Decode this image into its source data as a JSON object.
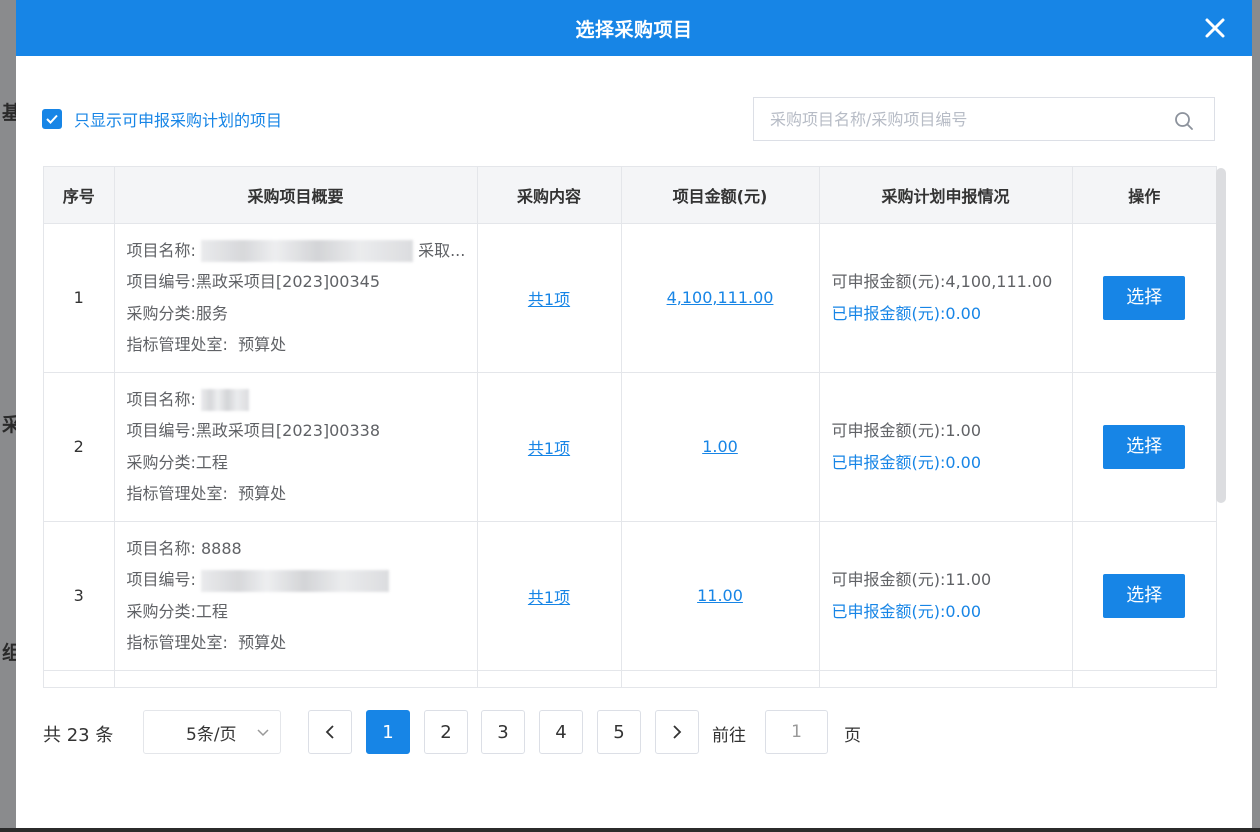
{
  "dialog": {
    "title": "选择采购项目"
  },
  "filter": {
    "checkbox_label": "只显示可申报采购计划的项目",
    "checked": true,
    "search_placeholder": "采购项目名称/采购项目编号",
    "search_value": ""
  },
  "table": {
    "headers": [
      "序号",
      "采购项目概要",
      "采购内容",
      "项目金额(元)",
      "采购计划申报情况",
      "操作"
    ],
    "rows": [
      {
        "index": "1",
        "name_label": "项目名称:",
        "name_value": "",
        "name_suffix": "采取...",
        "code_label": "项目编号:",
        "code_value": "黑政采项目[2023]00345",
        "category_label": "采购分类:",
        "category_value": "服务",
        "dept_label": "指标管理处室:",
        "dept_value": "预算处",
        "content": "共1项",
        "amount": "4,100,111.00",
        "avail_label": "可申报金额(元):",
        "avail_value": "4,100,111.00",
        "done_label": "已申报金额(元):",
        "done_value": "0.00",
        "action": "选择"
      },
      {
        "index": "2",
        "name_label": "项目名称:",
        "name_value": "",
        "name_suffix": "",
        "code_label": "项目编号:",
        "code_value": "黑政采项目[2023]00338",
        "category_label": "采购分类:",
        "category_value": "工程",
        "dept_label": "指标管理处室:",
        "dept_value": "预算处",
        "content": "共1项",
        "amount": "1.00",
        "avail_label": "可申报金额(元):",
        "avail_value": "1.00",
        "done_label": "已申报金额(元):",
        "done_value": "0.00",
        "action": "选择"
      },
      {
        "index": "3",
        "name_label": "项目名称:",
        "name_value": "8888",
        "name_suffix": "",
        "code_label": "项目编号:",
        "code_value": "",
        "category_label": "采购分类:",
        "category_value": "工程",
        "dept_label": "指标管理处室:",
        "dept_value": "预算处",
        "content": "共1项",
        "amount": "11.00",
        "avail_label": "可申报金额(元):",
        "avail_value": "11.00",
        "done_label": "已申报金额(元):",
        "done_value": "0.00",
        "action": "选择"
      }
    ]
  },
  "pagination": {
    "total_text": "共 23 条",
    "page_size": "5条/页",
    "pages": [
      "1",
      "2",
      "3",
      "4",
      "5"
    ],
    "current_page": "1",
    "goto_label": "前往",
    "goto_value": "1",
    "page_unit": "页"
  },
  "background": {
    "frag_1": "基",
    "frag_2": "采",
    "frag_3": "组"
  },
  "colors": {
    "primary": "#1785e6",
    "header_bg": "#f4f5f7",
    "border": "#e4e6ea"
  }
}
